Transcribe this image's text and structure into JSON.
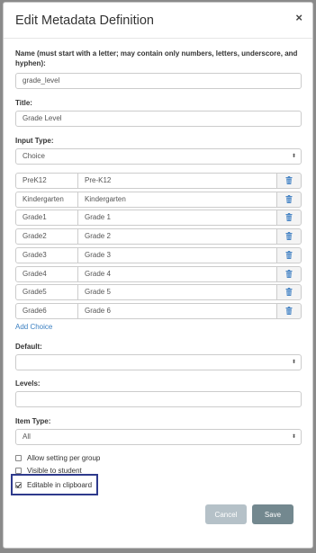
{
  "dialog": {
    "title": "Edit Metadata Definition",
    "close_glyph": "×"
  },
  "name_field": {
    "label": "Name (must start with a letter; may contain only numbers, letters, underscore, and hyphen):",
    "value": "grade_level"
  },
  "title_field": {
    "label": "Title:",
    "value": "Grade Level"
  },
  "input_type": {
    "label": "Input Type:",
    "value": "Choice"
  },
  "choices": [
    {
      "key": "PreK12",
      "value": "Pre-K12"
    },
    {
      "key": "Kindergarten",
      "value": "Kindergarten"
    },
    {
      "key": "Grade1",
      "value": "Grade 1"
    },
    {
      "key": "Grade2",
      "value": "Grade 2"
    },
    {
      "key": "Grade3",
      "value": "Grade 3"
    },
    {
      "key": "Grade4",
      "value": "Grade 4"
    },
    {
      "key": "Grade5",
      "value": "Grade 5"
    },
    {
      "key": "Grade6",
      "value": "Grade 6"
    }
  ],
  "add_choice_label": "Add Choice",
  "default_field": {
    "label": "Default:",
    "value": ""
  },
  "levels_field": {
    "label": "Levels:",
    "value": ""
  },
  "item_type": {
    "label": "Item Type:",
    "value": "All"
  },
  "checkboxes": [
    {
      "label": "Allow setting per group",
      "checked": false
    },
    {
      "label": "Visible to student",
      "checked": false
    },
    {
      "label": "Editable in clipboard",
      "checked": true
    }
  ],
  "buttons": {
    "cancel": "Cancel",
    "save": "Save"
  },
  "colors": {
    "link": "#3a7fc1",
    "trash": "#4a86c5",
    "highlight": "#2e3a8c",
    "save_bg": "#73888f",
    "cancel_bg": "#b5c1c8"
  },
  "icons": {
    "trash": "trash-icon",
    "caret": "select-caret-icon"
  }
}
